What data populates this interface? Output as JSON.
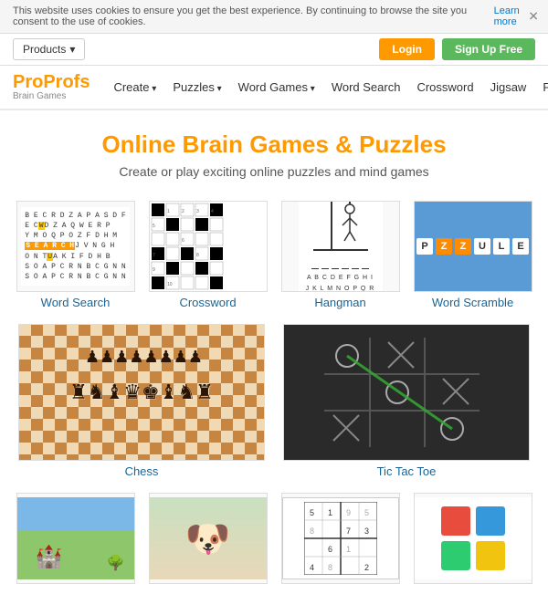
{
  "cookie": {
    "text": "This website uses cookies to ensure you get the best experience. By continuing to browse the site you consent to the use of cookies.",
    "link": "Learn more"
  },
  "topnav": {
    "products": "Products",
    "login": "Login",
    "signup": "Sign Up Free"
  },
  "logo": {
    "pro": "Pro",
    "profs": "Profs",
    "sub": "Brain Games"
  },
  "nav": {
    "create": "Create",
    "puzzles": "Puzzles",
    "word_games": "Word Games",
    "word_search": "Word Search",
    "crossword": "Crossword",
    "jigsaw": "Jigsaw",
    "family_fun": "Family Fun"
  },
  "hero": {
    "title": "Online Brain Games & Puzzles",
    "subtitle": "Create or play exciting online puzzles and mind games"
  },
  "games": [
    {
      "label": "Word Search"
    },
    {
      "label": "Crossword"
    },
    {
      "label": "Hangman"
    },
    {
      "label": "Word Scramble"
    },
    {
      "label": "Chess"
    },
    {
      "label": "Tic Tac Toe"
    }
  ],
  "bottom_games": [
    {
      "label": ""
    },
    {
      "label": ""
    },
    {
      "label": ""
    },
    {
      "label": ""
    }
  ],
  "colors": {
    "orange": "#f90",
    "blue": "#1a6496",
    "green": "#5cb85c"
  }
}
